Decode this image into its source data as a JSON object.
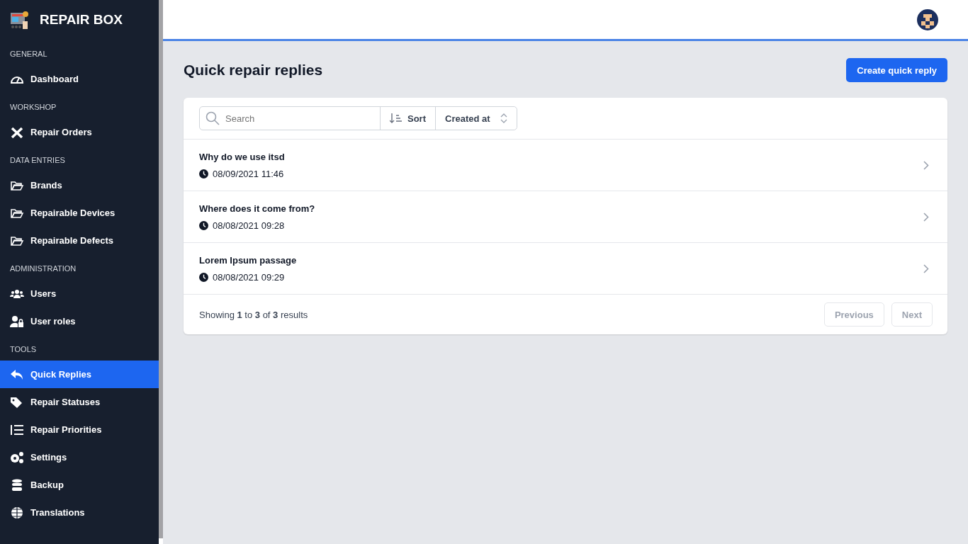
{
  "brand": {
    "title": "REPAIR BOX"
  },
  "sidebar": {
    "sections": [
      {
        "heading": "GENERAL",
        "items": [
          {
            "label": "Dashboard",
            "selected": false
          }
        ]
      },
      {
        "heading": "WORKSHOP",
        "items": [
          {
            "label": "Repair Orders",
            "selected": false
          }
        ]
      },
      {
        "heading": "DATA ENTRIES",
        "items": [
          {
            "label": "Brands",
            "selected": false
          },
          {
            "label": "Repairable Devices",
            "selected": false
          },
          {
            "label": "Repairable Defects",
            "selected": false
          }
        ]
      },
      {
        "heading": "ADMINISTRATION",
        "items": [
          {
            "label": "Users",
            "selected": false
          },
          {
            "label": "User roles",
            "selected": false
          }
        ]
      },
      {
        "heading": "TOOLS",
        "items": [
          {
            "label": "Quick Replies",
            "selected": true
          },
          {
            "label": "Repair Statuses",
            "selected": false
          },
          {
            "label": "Repair Priorities",
            "selected": false
          },
          {
            "label": "Settings",
            "selected": false
          },
          {
            "label": "Backup",
            "selected": false
          },
          {
            "label": "Translations",
            "selected": false
          }
        ]
      }
    ]
  },
  "page": {
    "title": "Quick repair replies",
    "create_button": "Create quick reply"
  },
  "toolbar": {
    "search": {
      "placeholder": "Search"
    },
    "sort_label": "Sort",
    "sort_field": "Created at"
  },
  "list": [
    {
      "title": "Why do we use itsd",
      "date": "08/09/2021 11:46"
    },
    {
      "title": "Where does it come from?",
      "date": "08/08/2021 09:28"
    },
    {
      "title": "Lorem Ipsum passage",
      "date": "08/08/2021 09:29"
    }
  ],
  "footer": {
    "summary": "Showing **1** to **3** of **3** results",
    "previous": {
      "label": "Previous",
      "disabled": true
    },
    "next": {
      "label": "Next",
      "disabled": true
    }
  }
}
